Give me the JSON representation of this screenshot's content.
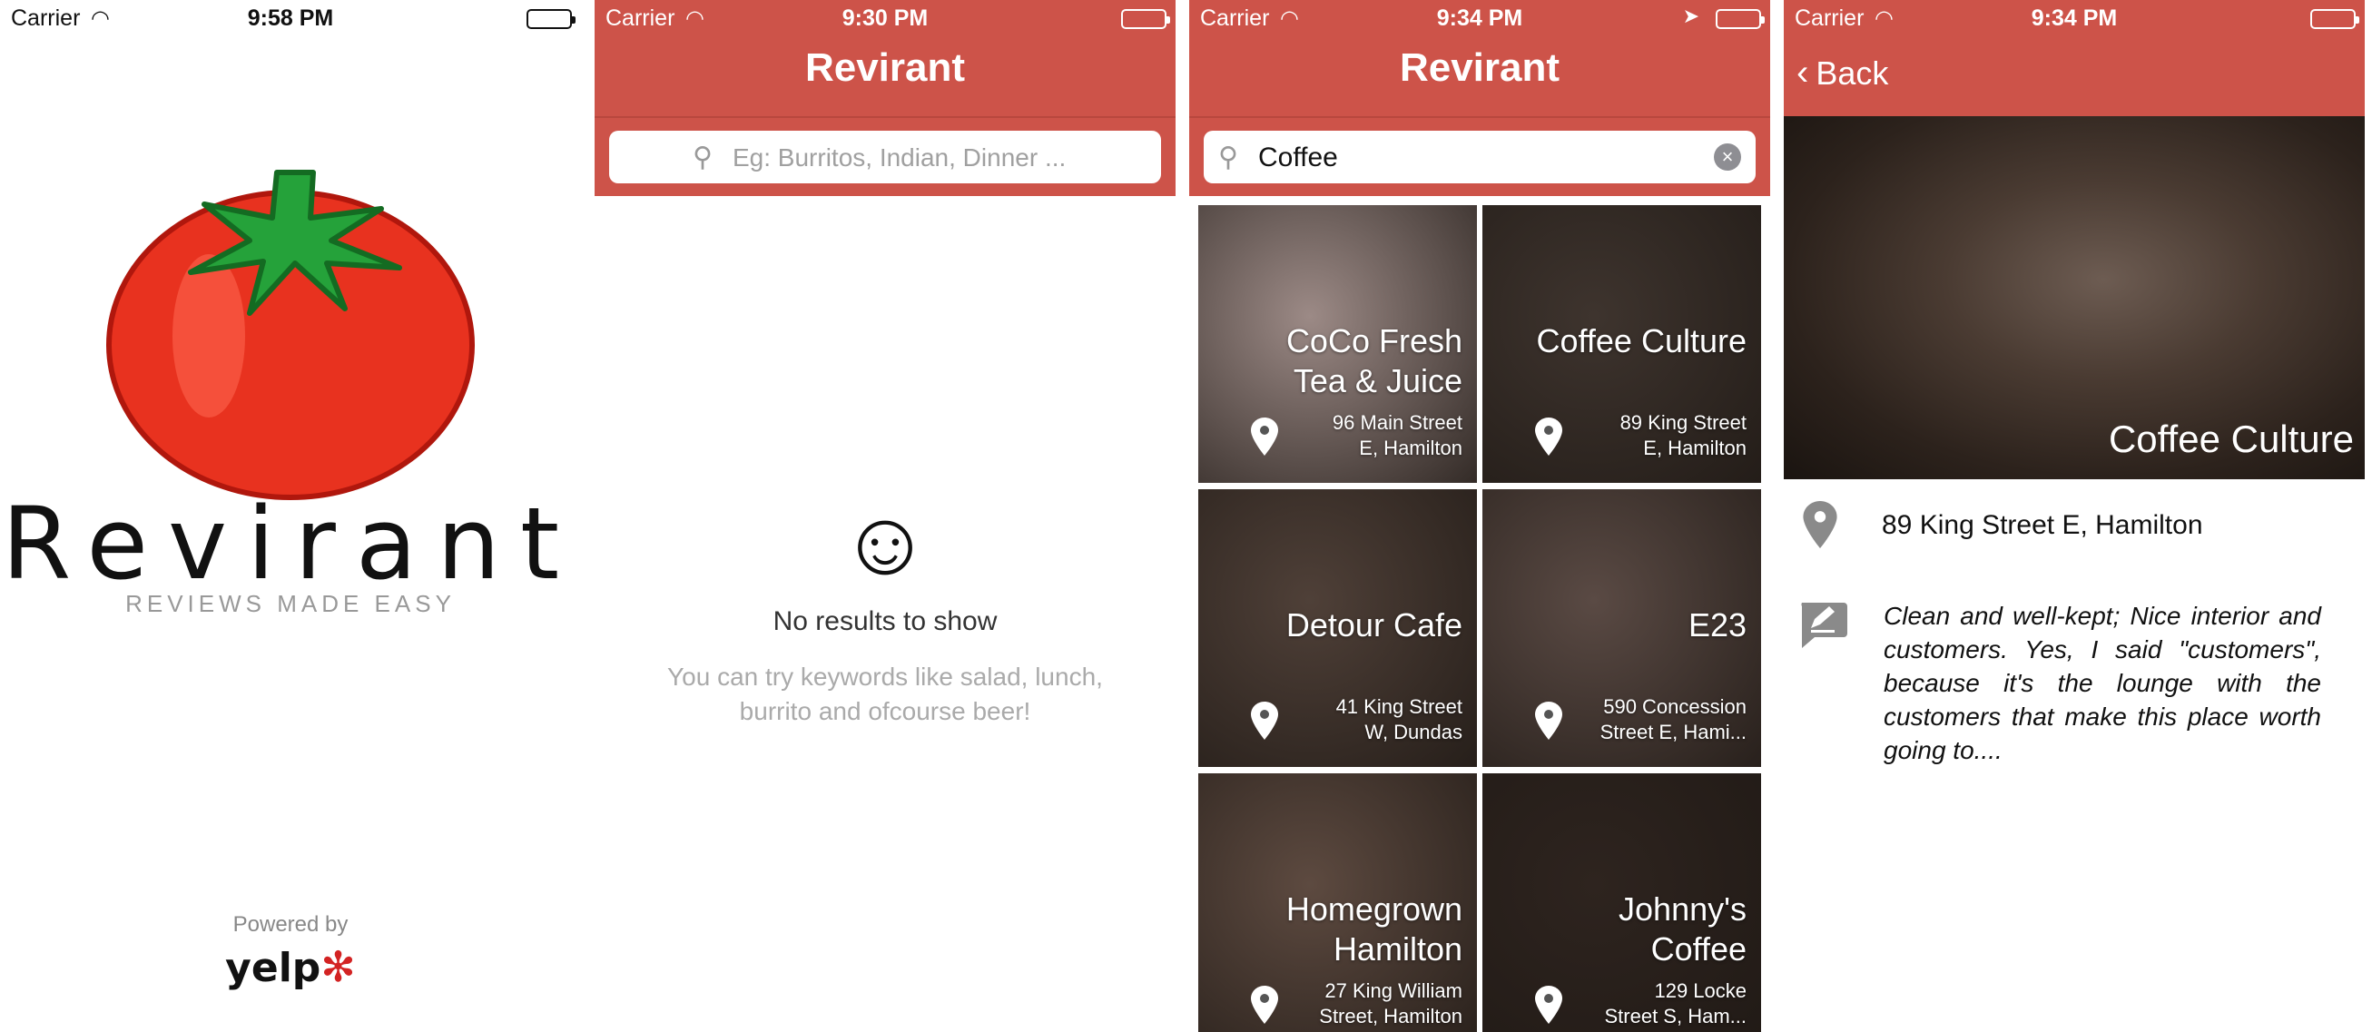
{
  "colors": {
    "brand_red": "#cd5349",
    "tomato_red": "#e8321f",
    "stem_green": "#25a23a"
  },
  "screen1": {
    "status": {
      "carrier": "Carrier",
      "time": "9:58 PM"
    },
    "brand": "Revirant",
    "tagline": "REVIEWS MADE EASY",
    "powered_by": "Powered by",
    "yelp": "yelp"
  },
  "screen2": {
    "status": {
      "carrier": "Carrier",
      "time": "9:30 PM"
    },
    "title": "Revirant",
    "search_placeholder": "Eg: Burritos, Indian, Dinner ...",
    "no_results": "No results to show",
    "hint": "You can try keywords like salad, lunch, burrito and ofcourse beer!"
  },
  "screen3": {
    "status": {
      "carrier": "Carrier",
      "time": "9:34 PM"
    },
    "title": "Revirant",
    "search_value": "Coffee",
    "results": [
      {
        "name_line1": "CoCo Fresh",
        "name_line2": "Tea & Juice",
        "addr_line1": "96 Main Street",
        "addr_line2": "E, Hamilton",
        "bg": "#9c8a86"
      },
      {
        "name_line1": "",
        "name_line2": "Coffee Culture",
        "addr_line1": "89 King Street",
        "addr_line2": "E, Hamilton",
        "bg": "#3e342e"
      },
      {
        "name_line1": "",
        "name_line2": "Detour Cafe",
        "addr_line1": "41 King Street",
        "addr_line2": "W, Dundas",
        "bg": "#4f4038"
      },
      {
        "name_line1": "",
        "name_line2": "E23",
        "addr_line1": "590 Concession",
        "addr_line2": "Street E, Hami...",
        "bg": "#5a4a44"
      },
      {
        "name_line1": "Homegrown",
        "name_line2": "Hamilton",
        "addr_line1": "27 King William",
        "addr_line2": "Street, Hamilton",
        "bg": "#5d4a40"
      },
      {
        "name_line1": "Johnny's",
        "name_line2": "Coffee",
        "addr_line1": "129 Locke",
        "addr_line2": "Street S, Ham...",
        "bg": "#2e241f"
      }
    ]
  },
  "screen4": {
    "status": {
      "carrier": "Carrier",
      "time": "9:34 PM"
    },
    "back_label": "Back",
    "name": "Coffee Culture",
    "address": "89 King Street E, Hamilton",
    "review": "Clean and well-kept; Nice interior and customers. Yes, I said \"customers\", because it's the lounge with the customers that make this place worth going to...."
  }
}
